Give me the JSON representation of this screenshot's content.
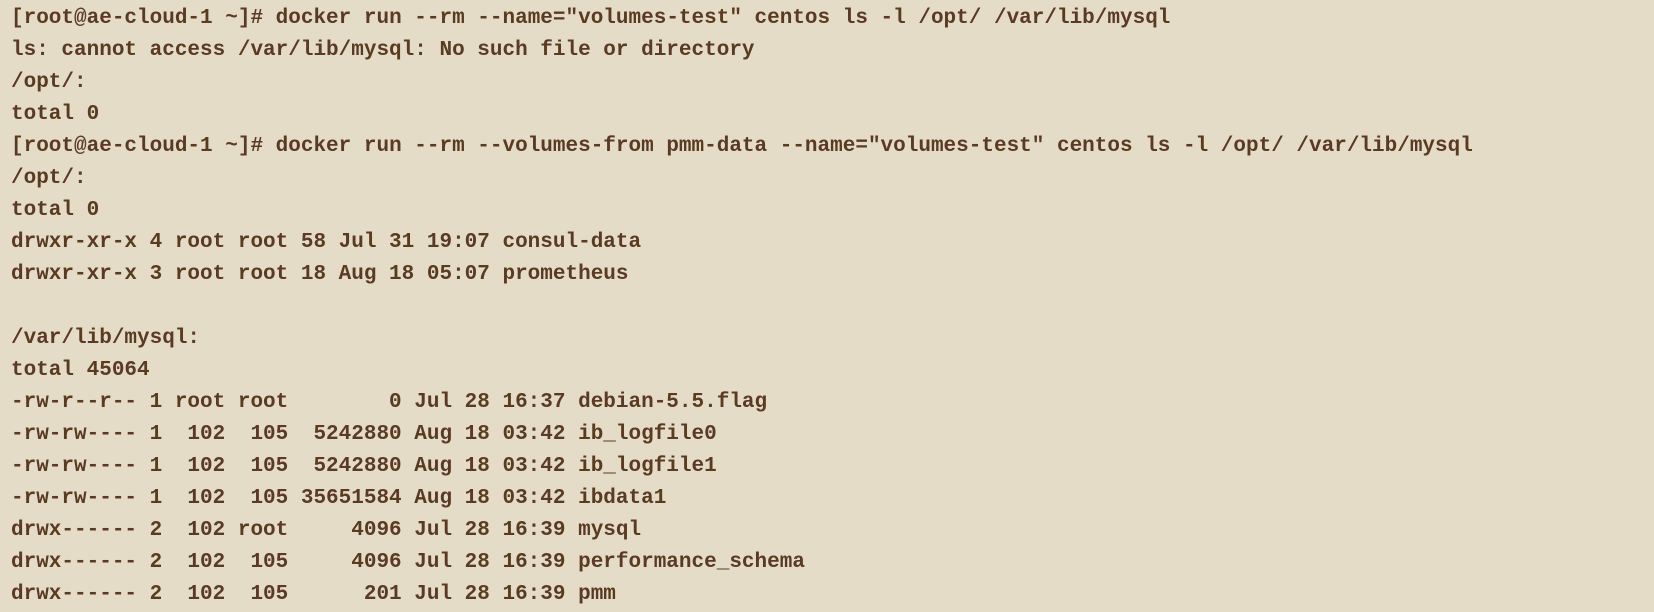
{
  "terminal": {
    "lines": [
      {
        "kind": "command",
        "prompt": "[root@ae-cloud-1 ~]#",
        "text": " docker run --rm --name=\"volumes-test\" centos ls -l /opt/ /var/lib/mysql"
      },
      {
        "kind": "output",
        "text": "ls: cannot access /var/lib/mysql: No such file or directory"
      },
      {
        "kind": "output",
        "text": "/opt/:"
      },
      {
        "kind": "output",
        "text": "total 0"
      },
      {
        "kind": "command",
        "prompt": "[root@ae-cloud-1 ~]#",
        "text": " docker run --rm --volumes-from pmm-data --name=\"volumes-test\" centos ls -l /opt/ /var/lib/mysql"
      },
      {
        "kind": "output",
        "text": "/opt/:"
      },
      {
        "kind": "output",
        "text": "total 0"
      },
      {
        "kind": "output",
        "text": "drwxr-xr-x 4 root root 58 Jul 31 19:07 consul-data"
      },
      {
        "kind": "output",
        "text": "drwxr-xr-x 3 root root 18 Aug 18 05:07 prometheus"
      },
      {
        "kind": "output",
        "text": ""
      },
      {
        "kind": "output",
        "text": "/var/lib/mysql:"
      },
      {
        "kind": "output",
        "text": "total 45064"
      },
      {
        "kind": "output",
        "text": "-rw-r--r-- 1 root root        0 Jul 28 16:37 debian-5.5.flag"
      },
      {
        "kind": "output",
        "text": "-rw-rw---- 1  102  105  5242880 Aug 18 03:42 ib_logfile0"
      },
      {
        "kind": "output",
        "text": "-rw-rw---- 1  102  105  5242880 Aug 18 03:42 ib_logfile1"
      },
      {
        "kind": "output",
        "text": "-rw-rw---- 1  102  105 35651584 Aug 18 03:42 ibdata1"
      },
      {
        "kind": "output",
        "text": "drwx------ 2  102 root     4096 Jul 28 16:39 mysql"
      },
      {
        "kind": "output",
        "text": "drwx------ 2  102  105     4096 Jul 28 16:39 performance_schema"
      },
      {
        "kind": "output",
        "text": "drwx------ 2  102  105      201 Jul 28 16:39 pmm"
      }
    ],
    "colors": {
      "background": "#e5dcc7",
      "text": "#5a3b22"
    }
  }
}
